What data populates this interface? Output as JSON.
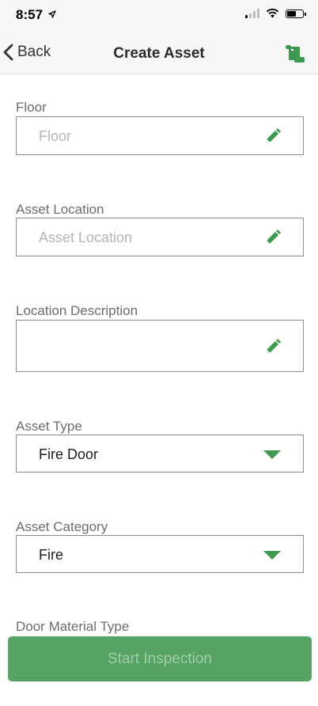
{
  "status_bar": {
    "time": "8:57"
  },
  "nav": {
    "back_label": "Back",
    "title": "Create Asset",
    "action_icon": "scroll-icon"
  },
  "form": {
    "floor": {
      "label": "Floor",
      "placeholder": "Floor",
      "value": ""
    },
    "asset_location": {
      "label": "Asset Location",
      "placeholder": "Asset Location",
      "value": ""
    },
    "location_description": {
      "label": "Location Description",
      "value": ""
    },
    "asset_type": {
      "label": "Asset Type",
      "selected": "Fire Door"
    },
    "asset_category": {
      "label": "Asset Category",
      "selected": "Fire"
    },
    "door_material_type": {
      "label": "Door Material Type"
    }
  },
  "footer": {
    "start_label": "Start Inspection"
  },
  "colors": {
    "accent": "#3e9a51",
    "button": "#56a464",
    "button_text": "#9fcca8"
  }
}
